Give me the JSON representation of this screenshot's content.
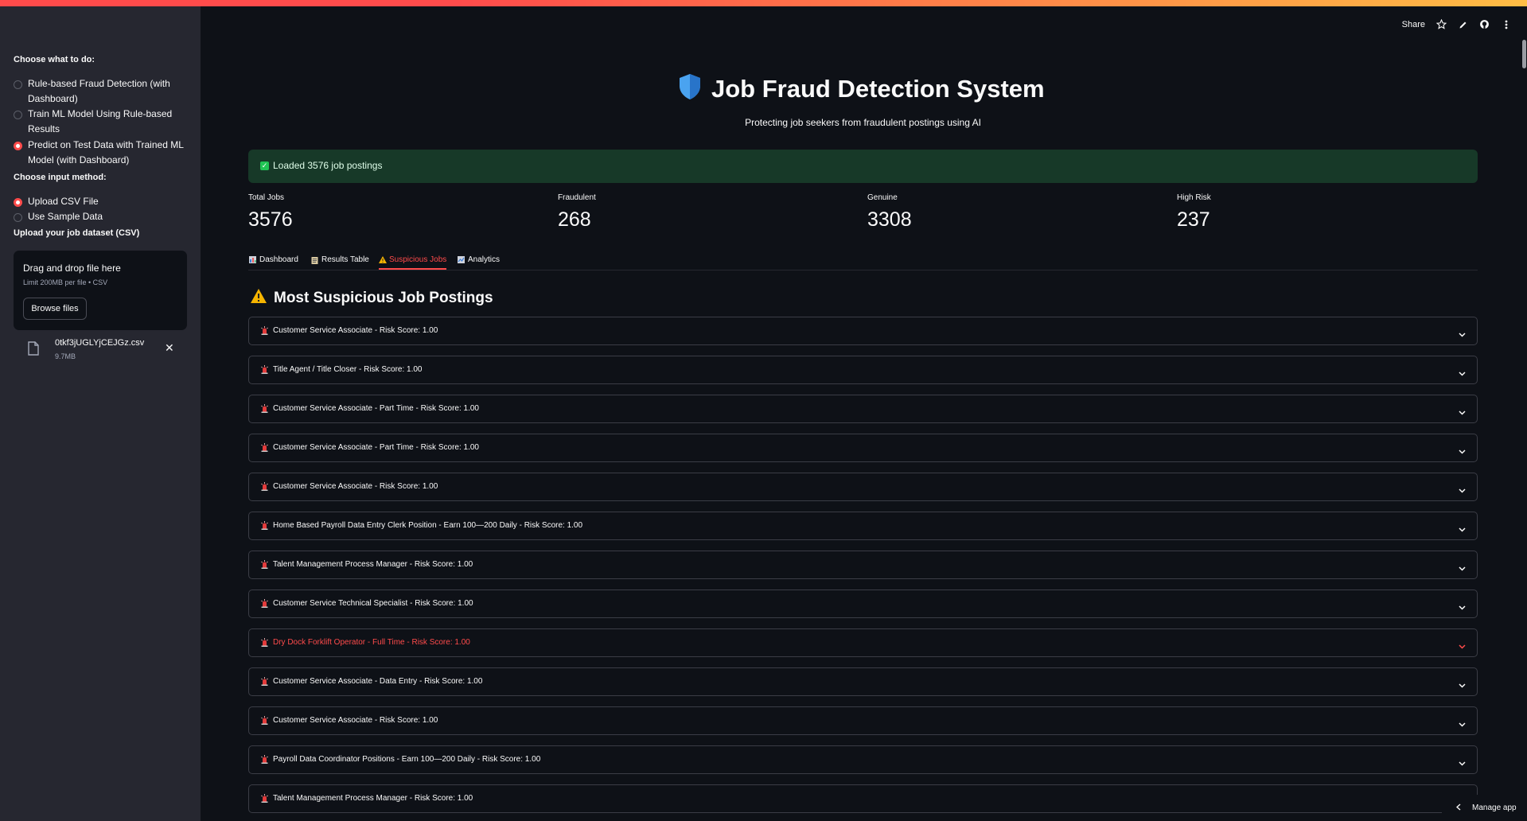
{
  "sidebar": {
    "task_label": "Choose what to do:",
    "task_options": [
      {
        "label": "Rule-based Fraud Detection (with Dashboard)",
        "selected": false
      },
      {
        "label": "Train ML Model Using Rule-based Results",
        "selected": false
      },
      {
        "label": "Predict on Test Data with Trained ML Model (with Dashboard)",
        "selected": true
      }
    ],
    "input_label": "Choose input method:",
    "input_options": [
      {
        "label": "Upload CSV File",
        "selected": true
      },
      {
        "label": "Use Sample Data",
        "selected": false
      }
    ],
    "upload_label": "Upload your job dataset (CSV)",
    "dropzone_title": "Drag and drop file here",
    "dropzone_limit": "Limit 200MB per file • CSV",
    "browse_label": "Browse files",
    "file_name": "0tkf3jUGLYjCEJGz.csv",
    "file_size": "9.7MB"
  },
  "topbar": {
    "share_label": "Share"
  },
  "header": {
    "title": "Job Fraud Detection System",
    "subtitle": "Protecting job seekers from fraudulent postings using AI"
  },
  "success_message": "Loaded 3576 job postings",
  "metrics": [
    {
      "label": "Total Jobs",
      "value": "3576"
    },
    {
      "label": "Fraudulent",
      "value": "268"
    },
    {
      "label": "Genuine",
      "value": "3308"
    },
    {
      "label": "High Risk",
      "value": "237"
    }
  ],
  "tabs": [
    {
      "label": "Dashboard",
      "icon": "bar-chart-icon"
    },
    {
      "label": "Results Table",
      "icon": "clipboard-icon"
    },
    {
      "label": "Suspicious Jobs",
      "icon": "warning-icon",
      "active": true
    },
    {
      "label": "Analytics",
      "icon": "line-chart-icon"
    }
  ],
  "section_title": "Most Suspicious Job Postings",
  "postings": [
    "Customer Service Associate - Risk Score: 1.00",
    "Title Agent / Title Closer - Risk Score: 1.00",
    "Customer Service Associate - Part Time - Risk Score: 1.00",
    "Customer Service Associate - Part Time - Risk Score: 1.00",
    "Customer Service Associate - Risk Score: 1.00",
    "Home Based Payroll Data Entry Clerk Position - Earn 100—200 Daily - Risk Score: 1.00",
    "Talent Management Process Manager - Risk Score: 1.00",
    "Customer Service Technical Specialist - Risk Score: 1.00",
    "Dry Dock Forklift Operator - Full Time - Risk Score: 1.00",
    "Customer Service Associate - Data Entry - Risk Score: 1.00",
    "Customer Service Associate - Risk Score: 1.00",
    "Payroll Data Coordinator Positions - Earn 100—200 Daily - Risk Score: 1.00",
    "Talent Management Process Manager - Risk Score: 1.00"
  ],
  "manage_app_label": "Manage app",
  "colors": {
    "accent": "#ff4b4b",
    "background": "#0e1117",
    "sidebar": "#262730",
    "success_bg": "#173928"
  }
}
